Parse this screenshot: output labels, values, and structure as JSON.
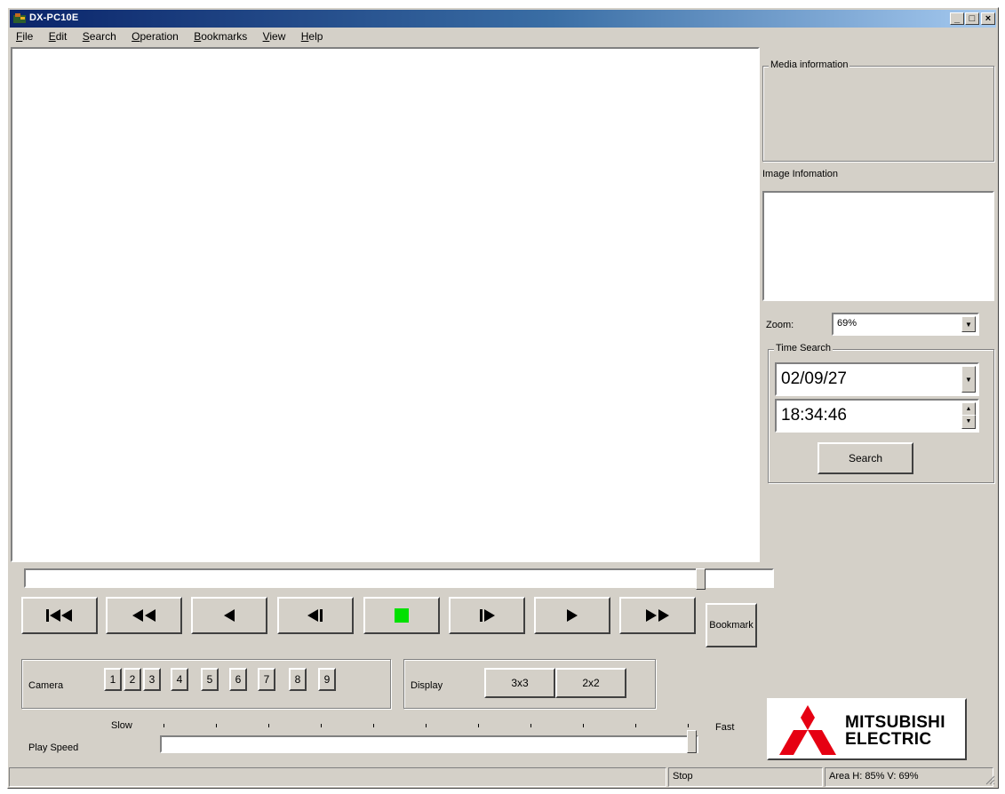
{
  "window": {
    "title": "DX-PC10E"
  },
  "menu": [
    {
      "label": "File",
      "key": "F",
      "rest": "ile"
    },
    {
      "label": "Edit",
      "key": "E",
      "rest": "dit"
    },
    {
      "label": "Search",
      "key": "S",
      "rest": "earch"
    },
    {
      "label": "Operation",
      "key": "O",
      "rest": "peration"
    },
    {
      "label": "Bookmarks",
      "key": "B",
      "rest": "ookmarks"
    },
    {
      "label": "View",
      "key": "V",
      "rest": "iew"
    },
    {
      "label": "Help",
      "key": "H",
      "rest": "elp"
    }
  ],
  "side": {
    "media_info_label": "Media information",
    "image_info_label": "Image Infomation",
    "zoom_label": "Zoom:",
    "zoom_value": "69%",
    "time_search_label": "Time Search",
    "date_value": "02/09/27",
    "time_value": "18:34:46",
    "search_button": "Search"
  },
  "playback": {
    "position": 0.91,
    "bookmark_button": "Bookmark",
    "controls": [
      "skip-to-start",
      "fast-rewind",
      "reverse-play",
      "step-back",
      "stop",
      "step-forward",
      "play",
      "fast-forward"
    ],
    "stop_color": "#00e000"
  },
  "camera": {
    "label": "Camera",
    "buttons": [
      "1",
      "2",
      "3",
      "4",
      "5",
      "6",
      "7",
      "8",
      "9"
    ]
  },
  "display": {
    "label": "Display",
    "buttons": [
      "3x3",
      "2x2"
    ]
  },
  "speed": {
    "label": "Play Speed",
    "slow": "Slow",
    "fast": "Fast",
    "value": 1.0
  },
  "logo": {
    "line1": "MITSUBISHI",
    "line2": "ELECTRIC",
    "color": "#e60012"
  },
  "status": {
    "state": "Stop",
    "area": "Area H: 85% V: 69%"
  }
}
